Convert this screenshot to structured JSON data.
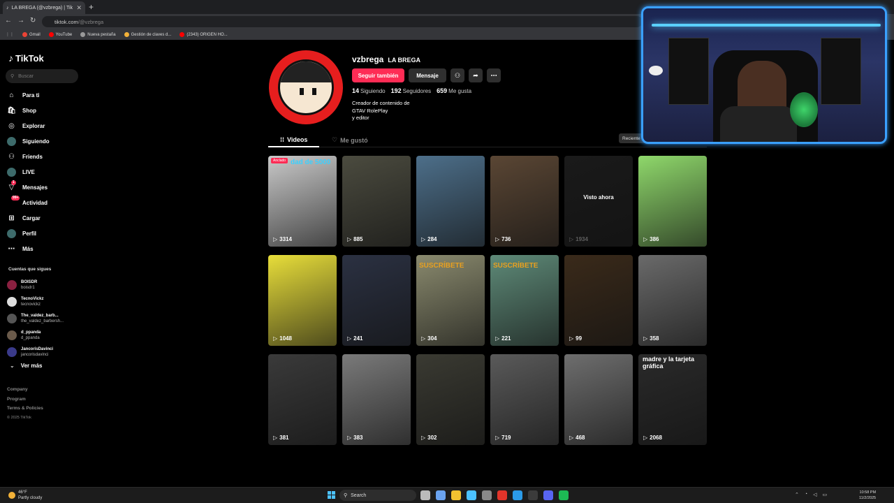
{
  "browser": {
    "tab_title": "LA BREGA (@vzbrega) | Tik",
    "tab_close": "✕",
    "new_tab": "+",
    "url_host": "tiktok.com",
    "url_path": "/@vzbrega",
    "bookmarks": [
      {
        "label": "Gmail",
        "color": "#ea4335"
      },
      {
        "label": "YouTube",
        "color": "#ff0000"
      },
      {
        "label": "Nueva pestaña",
        "color": "#999999"
      },
      {
        "label": "Gestión de claves d...",
        "color": "#f2b138"
      },
      {
        "label": "(2343) ORIGEN HO...",
        "color": "#ff0000"
      }
    ]
  },
  "sidebar": {
    "logo": "TikTok",
    "search_placeholder": "Buscar",
    "items": [
      {
        "label": "Para ti",
        "icon": "home-icon"
      },
      {
        "label": "Shop",
        "icon": "shop-icon"
      },
      {
        "label": "Explorar",
        "icon": "compass-icon"
      },
      {
        "label": "Siguiendo",
        "icon": "following-avatar"
      },
      {
        "label": "Friends",
        "icon": "friends-icon"
      },
      {
        "label": "LIVE",
        "icon": "live-avatar"
      },
      {
        "label": "Mensajes",
        "icon": "messages-icon",
        "badge": "1"
      },
      {
        "label": "Actividad",
        "icon": "activity-icon",
        "badge": "99+"
      },
      {
        "label": "Cargar",
        "icon": "upload-icon"
      },
      {
        "label": "Perfil",
        "icon": "profile-avatar"
      },
      {
        "label": "Más",
        "icon": "more-icon"
      }
    ],
    "follows_title": "Cuentas que sigues",
    "follows": [
      {
        "name": "BOISDR",
        "handle": "boisdr1",
        "color": "#8a2040"
      },
      {
        "name": "TecnoVickz",
        "handle": "tecnovickz",
        "color": "#dddddd"
      },
      {
        "name": "The_valdez_barb...",
        "handle": "the_valdez_barbersh...",
        "color": "#555555"
      },
      {
        "name": "d_ppanda",
        "handle": "d_ppanda",
        "color": "#6a5a4a"
      },
      {
        "name": "JancorisDavinci",
        "handle": "jancorisdavinci",
        "color": "#3a3a8a"
      }
    ],
    "see_more": "Ver más",
    "footer": [
      "Company",
      "Program",
      "Terms & Policies"
    ],
    "copyright": "© 2025 TikTok"
  },
  "profile": {
    "username": "vzbrega",
    "display_name": "LA BREGA",
    "follow_btn": "Seguir también",
    "message_btn": "Mensaje",
    "stats": [
      {
        "value": "14",
        "label": "Siguiendo"
      },
      {
        "value": "192",
        "label": "Seguidores"
      },
      {
        "value": "659",
        "label": "Me gusta"
      }
    ],
    "bio": [
      "Creador de contenido de",
      "GTAV RolePlay",
      "y editor"
    ],
    "tabs": {
      "videos": "Videos",
      "likes": "Me gustó"
    },
    "sort_label": "Reciente"
  },
  "videos": [
    {
      "views": "3314",
      "bg": "#c9c9c9",
      "overlay": "dad de 5000",
      "pinned": "Anclado"
    },
    {
      "views": "885",
      "bg": "#4b4b3f"
    },
    {
      "views": "284",
      "bg": "#4d6f8a"
    },
    {
      "views": "736",
      "bg": "#5a4634"
    },
    {
      "views": "1934",
      "bg": "#1a1a1a",
      "watched": "Visto ahora"
    },
    {
      "views": "386",
      "bg": "#8fd86b"
    },
    {
      "views": "1048",
      "bg": "#e8de3a"
    },
    {
      "views": "241",
      "bg": "#2b3142"
    },
    {
      "views": "304",
      "bg": "#8a8a6e",
      "overlay": "SUSCRÍBETE"
    },
    {
      "views": "221",
      "bg": "#5e8a78",
      "overlay": "SUSCRÍBETE"
    },
    {
      "views": "99",
      "bg": "#3a2a1a"
    },
    {
      "views": "358",
      "bg": "#6a6a6a"
    },
    {
      "views": "381",
      "bg": "#3a3a3a"
    },
    {
      "views": "383",
      "bg": "#7a7a7a"
    },
    {
      "views": "302",
      "bg": "#3a3a32"
    },
    {
      "views": "719",
      "bg": "#5a5a5a"
    },
    {
      "views": "468",
      "bg": "#6e6e6e"
    },
    {
      "views": "2068",
      "bg": "#2a2a2a",
      "overlay": "madre y la tarjeta gráfica"
    }
  ],
  "taskbar": {
    "temp": "46°F",
    "weather": "Partly cloudy",
    "search": "Search",
    "time": "10:58 PM",
    "date": "11/2/2025",
    "app_colors": [
      "#bbbbbb",
      "#6aa3f0",
      "#f2c230",
      "#4cc2ff",
      "#888888",
      "#e0342a",
      "#2b9be8",
      "#3b3b3b",
      "#5865f2",
      "#1db954"
    ]
  }
}
